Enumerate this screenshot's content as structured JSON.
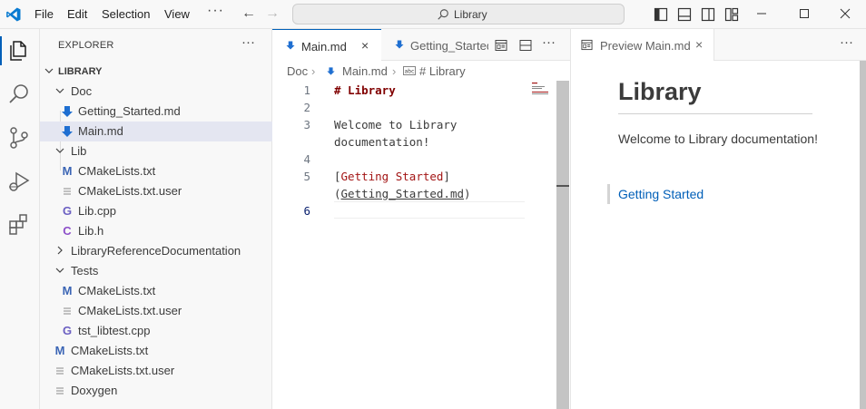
{
  "titlebar": {
    "menus": [
      "File",
      "Edit",
      "Selection",
      "View"
    ],
    "more": "···",
    "search_text": "Library"
  },
  "sidebar": {
    "title": "EXPLORER",
    "more": "···",
    "root": "LIBRARY",
    "items": [
      {
        "label": "Doc",
        "kind": "folder",
        "expanded": true
      },
      {
        "label": "Getting_Started.md",
        "kind": "markdown"
      },
      {
        "label": "Main.md",
        "kind": "markdown",
        "selected": true
      },
      {
        "label": "Lib",
        "kind": "folder",
        "expanded": true
      },
      {
        "label": "CMakeLists.txt",
        "kind": "cmake"
      },
      {
        "label": "CMakeLists.txt.user",
        "kind": "text"
      },
      {
        "label": "Lib.cpp",
        "kind": "cpp"
      },
      {
        "label": "Lib.h",
        "kind": "header"
      },
      {
        "label": "LibraryReferenceDocumentation",
        "kind": "folder",
        "expanded": false
      },
      {
        "label": "Tests",
        "kind": "folder",
        "expanded": true
      },
      {
        "label": "CMakeLists.txt",
        "kind": "cmake"
      },
      {
        "label": "CMakeLists.txt.user",
        "kind": "text"
      },
      {
        "label": "tst_libtest.cpp",
        "kind": "cpp"
      },
      {
        "label": "CMakeLists.txt",
        "kind": "cmake"
      },
      {
        "label": "CMakeLists.txt.user",
        "kind": "text"
      },
      {
        "label": "Doxygen",
        "kind": "text"
      }
    ]
  },
  "editor": {
    "tabs": [
      {
        "label": "Main.md",
        "close": "×",
        "active": true
      },
      {
        "label": "Getting_Started.md",
        "active": false
      }
    ],
    "more": "···",
    "breadcrumb": [
      "Doc",
      "Main.md",
      "# Library"
    ],
    "line_numbers": [
      "1",
      "2",
      "3",
      "4",
      "5",
      "6"
    ],
    "code": {
      "line1": "# Library",
      "line3a": "Welcome to Library",
      "line3b": "documentation!",
      "line5_open": "[",
      "line5_text": "Getting Started",
      "line5_close": "]",
      "line5b_open": "(",
      "line5b_url": "Getting_Started.md",
      "line5b_close": ")"
    }
  },
  "preview": {
    "tab_label": "Preview Main.md",
    "close": "×",
    "more": "···",
    "heading": "Library",
    "paragraph": "Welcome to Library documentation!",
    "link": "Getting Started"
  },
  "colors": {
    "accent": "#005fb8",
    "selection": "#e4e6f1",
    "markdown_icon": "#1f6fd1",
    "cmake_icon": "#3b65b5",
    "cpp_icon": "#6b5fc2"
  }
}
